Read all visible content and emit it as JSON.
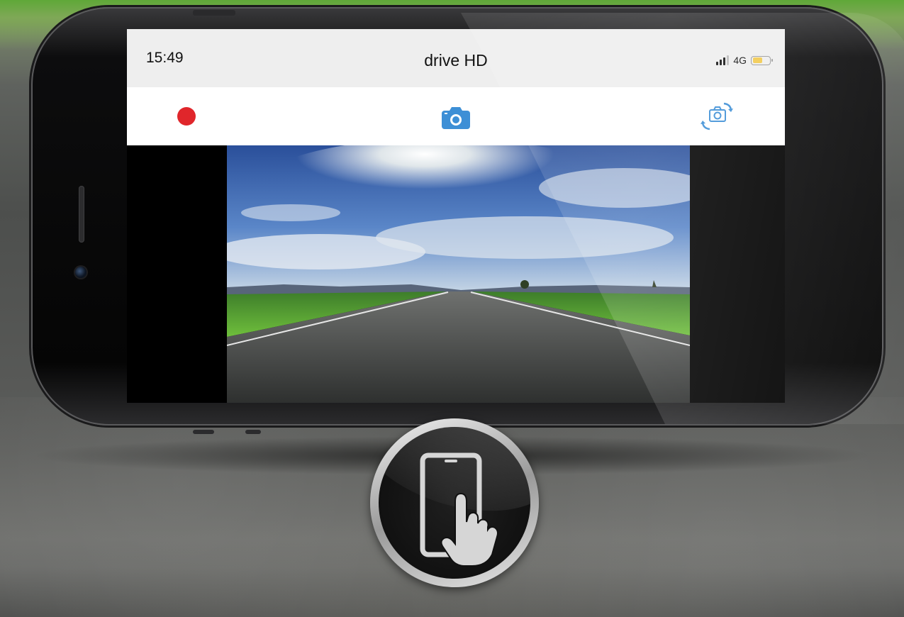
{
  "status_bar": {
    "time": "15:49",
    "app_title": "drive HD",
    "network": "4G",
    "battery_level": 0.6
  },
  "toolbar": {
    "record_icon": "record-icon",
    "snapshot_icon": "camera-icon",
    "switch_camera_icon": "switch-camera-icon"
  },
  "colors": {
    "record": "#e0262b",
    "accent": "#3d8fd6",
    "battery": "#f2c94c"
  },
  "badge": {
    "icon": "touch-screen-icon"
  }
}
